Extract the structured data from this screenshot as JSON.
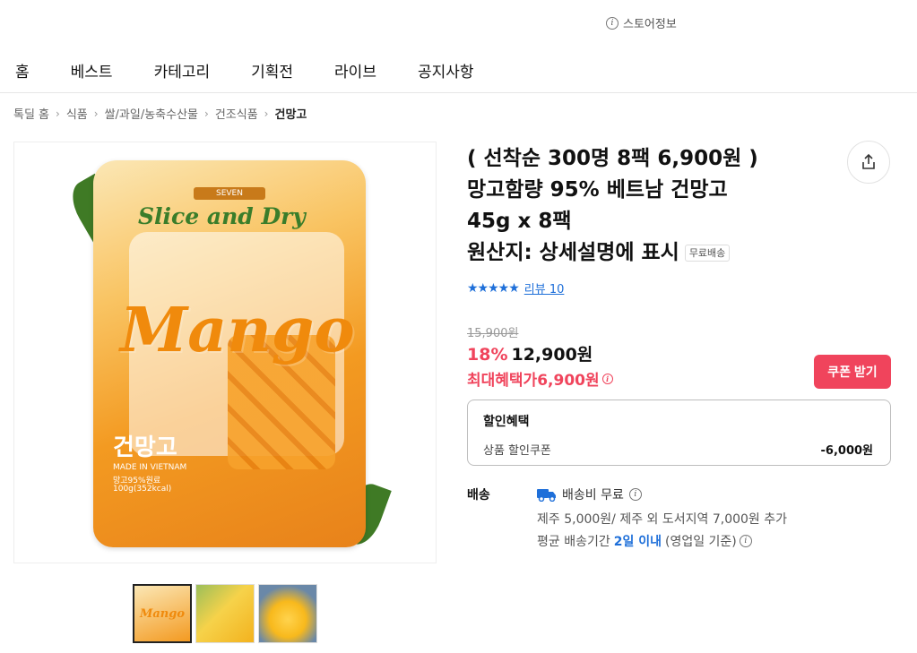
{
  "header": {
    "store_info_label": "스토어정보",
    "nav": [
      "홈",
      "베스트",
      "카테고리",
      "기획전",
      "라이브",
      "공지사항"
    ]
  },
  "breadcrumb": [
    "톡딜 홈",
    "식품",
    "쌀/과일/농축수산물",
    "건조식품",
    "건망고"
  ],
  "product": {
    "title_lines": [
      "( 선착순 300명 8팩 6,900원 )",
      "망고함량 95% 베트남 건망고",
      "45g x 8팩",
      "원산지: 상세설명에 표시"
    ],
    "free_shipping_badge": "무료배송",
    "stars": "★★★★★",
    "review_link": "리뷰 10",
    "original_price": "15,900원",
    "discount_rate": "18%",
    "price": "12,900원",
    "max_benefit_label": "최대혜택가",
    "max_benefit_price": "6,900원",
    "coupon_button": "쿠폰 받기",
    "image": {
      "brand": "SEVEN",
      "slogan": "Slice and Dry",
      "name": "Mango",
      "korean_name": "건망고",
      "made_in": "MADE IN VIETNAM",
      "line1": "망고95%원료",
      "line2": "100g(352kcal)"
    },
    "thumbnail_label": "Mango"
  },
  "discount_box": {
    "title": "할인혜택",
    "row_label": "상품 할인쿠폰",
    "row_value": "-6,000원"
  },
  "shipping": {
    "label": "배송",
    "fee": "배송비 무료",
    "extra": "제주 5,000원/ 제주 외 도서지역 7,000원 추가",
    "avg_prefix": "평균 배송기간",
    "avg_days": "2일 이내",
    "avg_suffix": "(영업일 기준)"
  },
  "colors": {
    "accent_red": "#f0445c",
    "link_blue": "#1e6fd9"
  }
}
